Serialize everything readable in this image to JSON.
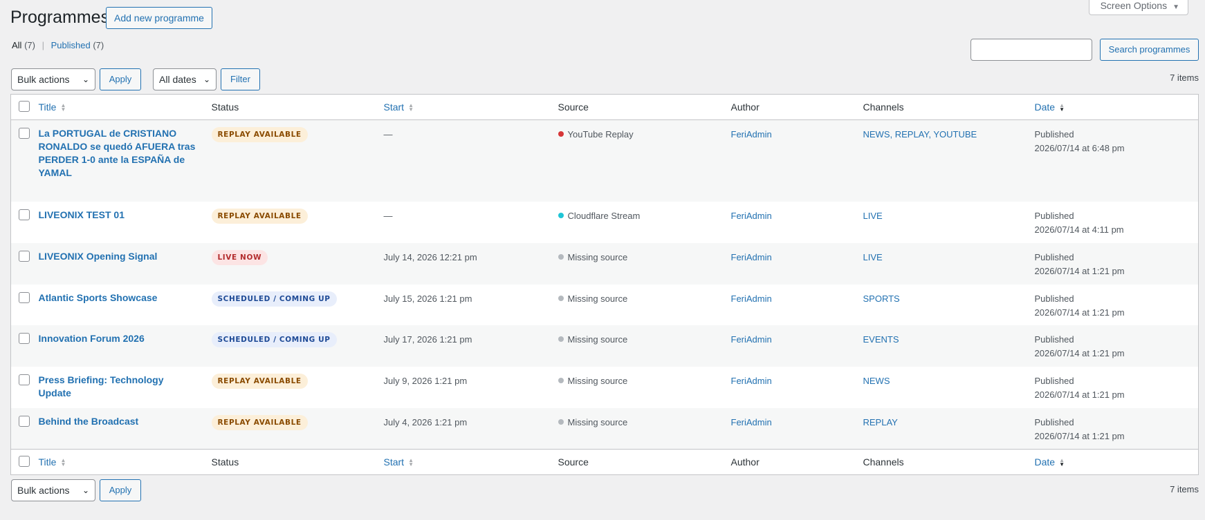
{
  "header": {
    "title": "Programmes",
    "add_new_label": "Add new programme",
    "screen_options_label": "Screen Options"
  },
  "views": {
    "all_label": "All",
    "all_count": "(7)",
    "separator": "|",
    "published_label": "Published",
    "published_count": "(7)"
  },
  "search": {
    "value": "",
    "button_label": "Search programmes"
  },
  "top_nav": {
    "bulk_actions": "Bulk actions",
    "apply_label": "Apply",
    "dates_filter": "All dates",
    "filter_label": "Filter",
    "items_count": "7 items"
  },
  "bottom_nav": {
    "bulk_actions": "Bulk actions",
    "apply_label": "Apply",
    "items_count": "7 items"
  },
  "columns": {
    "title": "Title",
    "status": "Status",
    "start": "Start",
    "source": "Source",
    "author": "Author",
    "channels": "Channels",
    "date": "Date"
  },
  "colors": {
    "youtube_dot": "#d63638",
    "cloudflare_dot": "#1fc5d6",
    "missing_dot": "#b4b9be"
  },
  "rows": [
    {
      "title": "La PORTUGAL de CRISTIANO RONALDO se quedó AFUERA tras PERDER 1-0 ante la ESPAÑA de YAMAL",
      "status": "REPLAY AVAILABLE",
      "status_type": "replay",
      "start": "—",
      "source": "YouTube Replay",
      "source_type": "youtube",
      "author": "FeriAdmin",
      "channels": "NEWS, REPLAY, YOUTUBE",
      "date_status": "Published",
      "date": "2026/07/14 at 6:48 pm"
    },
    {
      "title": "LIVEONIX TEST 01",
      "status": "REPLAY AVAILABLE",
      "status_type": "replay",
      "start": "—",
      "source": "Cloudflare Stream",
      "source_type": "cloudflare",
      "author": "FeriAdmin",
      "channels": "LIVE",
      "date_status": "Published",
      "date": "2026/07/14 at 4:11 pm"
    },
    {
      "title": "LIVEONIX Opening Signal",
      "status": "LIVE NOW",
      "status_type": "live",
      "start": "July 14, 2026 12:21 pm",
      "source": "Missing source",
      "source_type": "missing",
      "author": "FeriAdmin",
      "channels": "LIVE",
      "date_status": "Published",
      "date": "2026/07/14 at 1:21 pm"
    },
    {
      "title": "Atlantic Sports Showcase",
      "status": "SCHEDULED / COMING UP",
      "status_type": "scheduled",
      "start": "July 15, 2026 1:21 pm",
      "source": "Missing source",
      "source_type": "missing",
      "author": "FeriAdmin",
      "channels": "SPORTS",
      "date_status": "Published",
      "date": "2026/07/14 at 1:21 pm"
    },
    {
      "title": "Innovation Forum 2026",
      "status": "SCHEDULED / COMING UP",
      "status_type": "scheduled",
      "start": "July 17, 2026 1:21 pm",
      "source": "Missing source",
      "source_type": "missing",
      "author": "FeriAdmin",
      "channels": "EVENTS",
      "date_status": "Published",
      "date": "2026/07/14 at 1:21 pm"
    },
    {
      "title": "Press Briefing: Technology Update",
      "status": "REPLAY AVAILABLE",
      "status_type": "replay",
      "start": "July 9, 2026 1:21 pm",
      "source": "Missing source",
      "source_type": "missing",
      "author": "FeriAdmin",
      "channels": "NEWS",
      "date_status": "Published",
      "date": "2026/07/14 at 1:21 pm"
    },
    {
      "title": "Behind the Broadcast",
      "status": "REPLAY AVAILABLE",
      "status_type": "replay",
      "start": "July 4, 2026 1:21 pm",
      "source": "Missing source",
      "source_type": "missing",
      "author": "FeriAdmin",
      "channels": "REPLAY",
      "date_status": "Published",
      "date": "2026/07/14 at 1:21 pm"
    }
  ]
}
